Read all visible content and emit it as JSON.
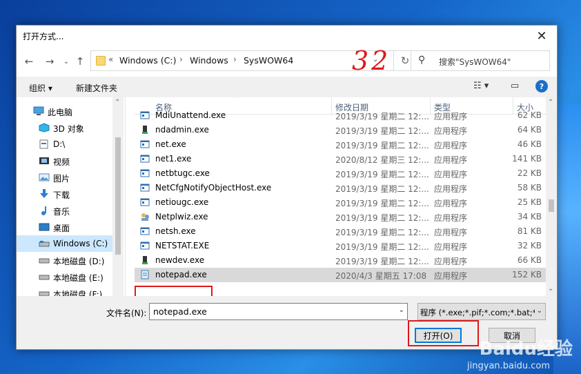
{
  "window": {
    "title": "打开方式..."
  },
  "address": {
    "crumbs": [
      "Windows (C:)",
      "Windows",
      "SysWOW64"
    ],
    "prefix": "«",
    "annotation": "32"
  },
  "search": {
    "placeholder": "搜索\"SysWOW64\""
  },
  "toolbar": {
    "organize": "组织 ▾",
    "new_folder": "新建文件夹"
  },
  "sidebar": {
    "items": [
      {
        "label": "此电脑",
        "icon": "pc-icon"
      },
      {
        "label": "3D 对象",
        "icon": "3d-objects-icon"
      },
      {
        "label": "D:\\",
        "icon": "folder-icon"
      },
      {
        "label": "视频",
        "icon": "video-icon"
      },
      {
        "label": "图片",
        "icon": "pictures-icon"
      },
      {
        "label": "下载",
        "icon": "download-icon"
      },
      {
        "label": "音乐",
        "icon": "music-icon"
      },
      {
        "label": "桌面",
        "icon": "desktop-icon"
      },
      {
        "label": "Windows (C:)",
        "icon": "drive-icon",
        "selected": true
      },
      {
        "label": "本地磁盘 (D:)",
        "icon": "drive-icon"
      },
      {
        "label": "本地磁盘 (E:)",
        "icon": "drive-icon"
      },
      {
        "label": "本地磁盘 (F:)",
        "icon": "drive-icon"
      }
    ]
  },
  "columns": {
    "name": "名称",
    "date": "修改日期",
    "type": "类型",
    "size": "大小"
  },
  "files": [
    {
      "name": "MdiUnattend.exe",
      "date": "2019/3/19 星期二 12:...",
      "type": "应用程序",
      "size": "62 KB",
      "icon": "exe-icon"
    },
    {
      "name": "ndadmin.exe",
      "date": "2019/3/19 星期二 12:...",
      "type": "应用程序",
      "size": "64 KB",
      "icon": "admin-exe-icon"
    },
    {
      "name": "net.exe",
      "date": "2019/3/19 星期二 12:...",
      "type": "应用程序",
      "size": "46 KB",
      "icon": "exe-icon"
    },
    {
      "name": "net1.exe",
      "date": "2020/8/12 星期三 12:...",
      "type": "应用程序",
      "size": "141 KB",
      "icon": "exe-icon"
    },
    {
      "name": "netbtugc.exe",
      "date": "2019/3/19 星期二 12:...",
      "type": "应用程序",
      "size": "22 KB",
      "icon": "exe-icon"
    },
    {
      "name": "NetCfgNotifyObjectHost.exe",
      "date": "2019/3/19 星期二 12:...",
      "type": "应用程序",
      "size": "58 KB",
      "icon": "exe-icon"
    },
    {
      "name": "netiougc.exe",
      "date": "2019/3/19 星期二 12:...",
      "type": "应用程序",
      "size": "25 KB",
      "icon": "exe-icon"
    },
    {
      "name": "Netplwiz.exe",
      "date": "2019/3/19 星期二 12:...",
      "type": "应用程序",
      "size": "34 KB",
      "icon": "users-exe-icon"
    },
    {
      "name": "netsh.exe",
      "date": "2019/3/19 星期二 12:...",
      "type": "应用程序",
      "size": "81 KB",
      "icon": "exe-icon"
    },
    {
      "name": "NETSTAT.EXE",
      "date": "2019/3/19 星期二 12:...",
      "type": "应用程序",
      "size": "32 KB",
      "icon": "exe-icon"
    },
    {
      "name": "newdev.exe",
      "date": "2019/3/19 星期二 12:...",
      "type": "应用程序",
      "size": "66 KB",
      "icon": "admin-exe-icon"
    },
    {
      "name": "notepad.exe",
      "date": "2020/4/3 星期五 17:08",
      "type": "应用程序",
      "size": "152 KB",
      "icon": "notepad-icon",
      "selected": true
    }
  ],
  "bottom": {
    "filename_label": "文件名(N):",
    "filename_value": "notepad.exe",
    "filetype": "程序 (*.exe;*.pif;*.com;*.bat;*.",
    "open_label": "打开(O)",
    "cancel_label": "取消"
  },
  "watermark": {
    "brand": "Baidu经验",
    "url": "jingyan.baidu.com"
  },
  "colors": {
    "accent": "#0078d7",
    "selection": "#cce8ff",
    "highlight_box": "#e01818"
  }
}
